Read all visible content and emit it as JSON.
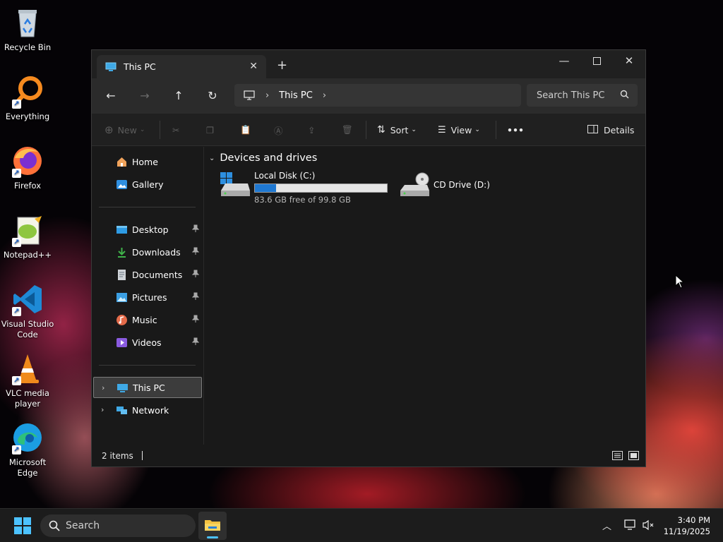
{
  "desktop": {
    "icons": [
      {
        "label": "Recycle Bin"
      },
      {
        "label": "Everything"
      },
      {
        "label": "Firefox"
      },
      {
        "label": "Notepad++"
      },
      {
        "label": "Visual Studio Code"
      },
      {
        "label": "VLC media player"
      },
      {
        "label": "Microsoft Edge"
      }
    ]
  },
  "window": {
    "tab_title": "This PC",
    "new_tab_symbol": "+",
    "address": {
      "crumb": "This PC"
    },
    "search": {
      "placeholder": "Search This PC"
    },
    "commands": {
      "new": "New",
      "sort": "Sort",
      "view": "View",
      "more": "•••",
      "details": "Details"
    },
    "nav": {
      "top": [
        {
          "label": "Home"
        },
        {
          "label": "Gallery"
        }
      ],
      "pinned": [
        {
          "label": "Desktop"
        },
        {
          "label": "Downloads"
        },
        {
          "label": "Documents"
        },
        {
          "label": "Pictures"
        },
        {
          "label": "Music"
        },
        {
          "label": "Videos"
        }
      ],
      "tree": [
        {
          "label": "This PC",
          "selected": true
        },
        {
          "label": "Network"
        }
      ]
    },
    "content": {
      "group_title": "Devices and drives",
      "drives": [
        {
          "name": "Local Disk (C:)",
          "free_text": "83.6 GB free of 99.8 GB",
          "used_fraction": 0.162
        },
        {
          "name": "CD Drive (D:)"
        }
      ]
    },
    "status": {
      "items": "2 items"
    }
  },
  "taskbar": {
    "search_label": "Search",
    "time": "3:40 PM",
    "date": "11/19/2025"
  },
  "colors": {
    "accent": "#1f78d1",
    "window_bg": "#191919"
  }
}
